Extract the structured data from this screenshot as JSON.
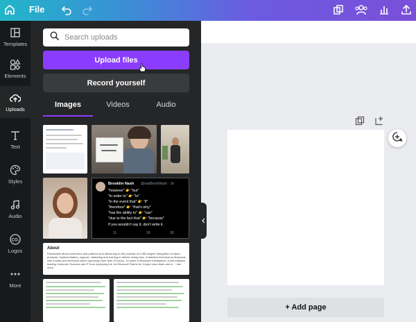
{
  "topbar": {
    "file_label": "File",
    "icons": [
      "home-icon",
      "undo-icon",
      "redo-icon",
      "resize-icon",
      "share-people-icon",
      "insights-icon",
      "upload-icon"
    ]
  },
  "rail": {
    "items": [
      {
        "label": "Templates",
        "icon": "templates-icon"
      },
      {
        "label": "Elements",
        "icon": "elements-icon"
      },
      {
        "label": "Uploads",
        "icon": "uploads-icon",
        "active": true
      },
      {
        "label": "Text",
        "icon": "text-icon"
      },
      {
        "label": "Styles",
        "icon": "styles-icon"
      },
      {
        "label": "Audio",
        "icon": "audio-icon"
      },
      {
        "label": "Logos",
        "icon": "logos-icon"
      },
      {
        "label": "More",
        "icon": "more-icon"
      }
    ]
  },
  "panel": {
    "search_placeholder": "Search uploads",
    "upload_label": "Upload files",
    "record_label": "Record yourself",
    "tabs": [
      {
        "label": "Images",
        "active": true
      },
      {
        "label": "Videos"
      },
      {
        "label": "Audio"
      }
    ],
    "tweet": {
      "name": "Brooklin Nash",
      "handle": "@realBrookNash · 1h",
      "lines": [
        "\"however\" 👉 \"but\"",
        "\"in order to\" 👉 \"to\"",
        "\"in the event that\" 👉 \"if\"",
        "\"therefore\" 👉 \"that's why\"",
        "\"has the ability to\" 👉 \"can\"",
        "\"due to the fact that\" 👉 \"because\""
      ],
      "footer": "If you wouldn't say it, don't write it.",
      "stats": [
        "11",
        "18",
        "39"
      ]
    },
    "about": {
      "title": "About",
      "text": "Passionate about customers and partners and delivering on the promise of a 360 degree integration of sales, products, implementation, support, marketing and training to deliver raving fans. A talented technical professional with a sales and technical career spanning more than 20 years. 10 years in Business Intelligence. A self-initiative leading Customer Success and IT from deploying the 1st Microsoft Teams for Crypto Uses team and w ... see more"
    }
  },
  "canvas": {
    "add_page_label": "+ Add page"
  },
  "colors": {
    "accent": "#8b3dff",
    "rail_bg": "#18191b",
    "panel_bg": "#252627"
  }
}
